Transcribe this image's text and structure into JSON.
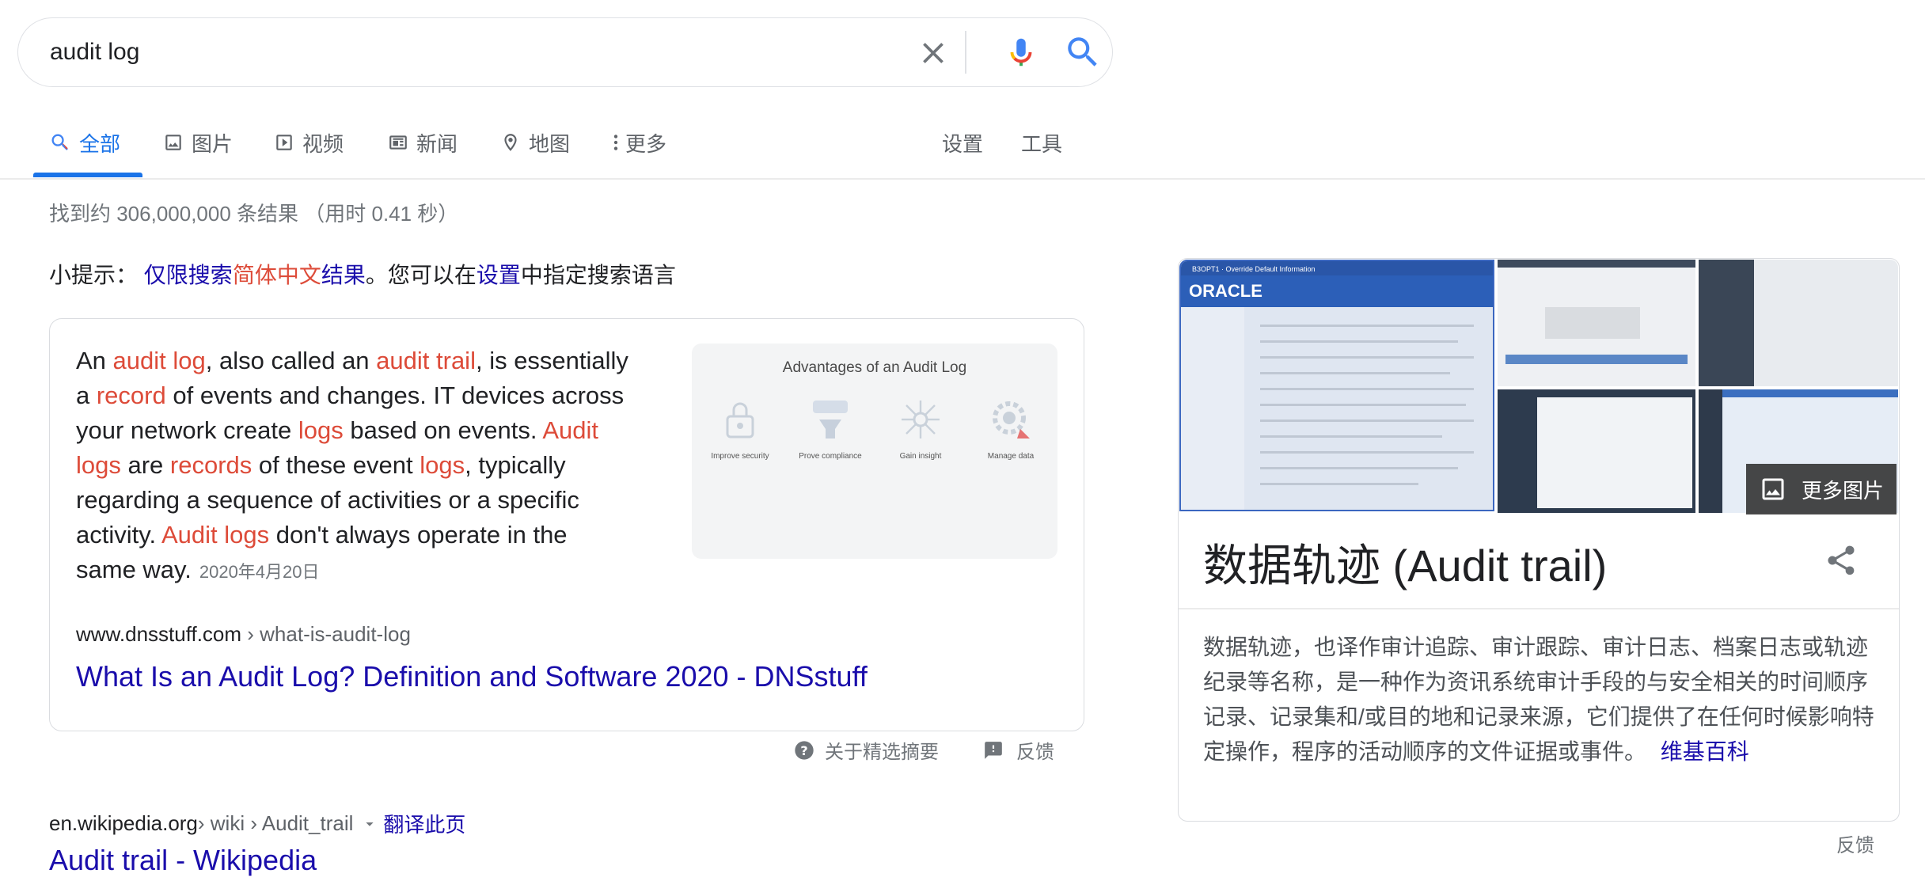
{
  "search": {
    "query": "audit log"
  },
  "tabs": [
    {
      "label": "全部",
      "icon": "search-icon",
      "active": true
    },
    {
      "label": "图片",
      "icon": "image-icon"
    },
    {
      "label": "视频",
      "icon": "video-icon"
    },
    {
      "label": "新闻",
      "icon": "news-icon"
    },
    {
      "label": "地图",
      "icon": "map-pin-icon"
    },
    {
      "label": "更多",
      "icon": "more-vert-icon"
    }
  ],
  "tools": {
    "settings": "设置",
    "tools": "工具"
  },
  "result_stats": "找到约 306,000,000 条结果 （用时 0.41 秒）",
  "tip": {
    "prefix": "小提示：",
    "link1": "仅限搜索",
    "lang": "简体中文",
    "link2": "结果",
    "middle": "。您可以在",
    "settings_link": "设置",
    "suffix": "中指定搜索语言"
  },
  "snippet": {
    "t1": "An ",
    "e1": "audit log",
    "t2": ", also called an ",
    "e2": "audit trail",
    "t3": ", is essentially a ",
    "e3": "record",
    "t4": " of events and changes. IT devices across your network create ",
    "e4": "logs",
    "t5": " based on events. ",
    "e5": "Audit logs",
    "t6": " are ",
    "e6": "records",
    "t7": " of these event ",
    "e7": "logs",
    "t8": ", typically regarding a sequence of activities or a specific activity. ",
    "e8": "Audit logs",
    "t9": " don't always operate in the same way.",
    "date": "2020年4月20日",
    "image": {
      "title": "Advantages of an Audit Log",
      "items": [
        "Improve security",
        "Prove compliance",
        "Gain insight",
        "Manage data"
      ]
    },
    "cite_domain": "www.dnsstuff.com",
    "cite_path": " › what-is-audit-log",
    "title": "What Is an Audit Log? Definition and Software 2020 - DNSstuff",
    "about": "关于精选摘要",
    "feedback": "反馈"
  },
  "result2": {
    "cite_domain": "en.wikipedia.org",
    "cite_path": " › wiki › Audit_trail",
    "translate": "翻译此页",
    "title": "Audit trail - Wikipedia"
  },
  "knowledge_panel": {
    "more_images": "更多图片",
    "title": "数据轨迹 (Audit trail)",
    "description": "数据轨迹，也译作审计追踪、审计跟踪、审计日志、档案日志或轨迹纪录等名称，是一种作为资讯系统审计手段的与安全相关的时间顺序记录、记录集和/或目的地和记录来源，它们提供了在任何时候影响特定操作，程序的活动顺序的文件证据或事件。",
    "source": "维基百科",
    "feedback": "反馈",
    "image_main_brand": "ORACLE",
    "image_main_header": "B3OPT1 · Override Default Information"
  },
  "colors": {
    "accent": "#1a73e8",
    "link": "#1a0dab",
    "highlight": "#dd4b39"
  }
}
